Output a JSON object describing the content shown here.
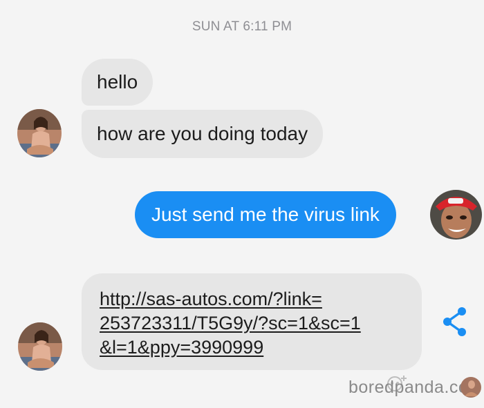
{
  "thread": {
    "timestamp": "SUN AT 6:11 PM",
    "messages": [
      {
        "sender": "other",
        "text": "hello"
      },
      {
        "sender": "other",
        "text": "how are you doing today"
      },
      {
        "sender": "me",
        "text": "Just send me the virus link"
      },
      {
        "sender": "other",
        "link_lines": [
          "http://sas-autos.com/?link=",
          "253723311/T5G9y/?sc=1&sc=1",
          "&l=1&ppy=3990999"
        ]
      }
    ]
  },
  "icons": {
    "share": "share-icon",
    "watermark_logo": "boredpanda-icon"
  },
  "colors": {
    "background": "#f4f4f4",
    "incoming_bubble": "#e6e6e6",
    "outgoing_bubble": "#1a8ef3",
    "timestamp": "#8e8e93",
    "share_icon": "#1a8ef3"
  },
  "watermark": {
    "text": "boredpanda.co"
  }
}
